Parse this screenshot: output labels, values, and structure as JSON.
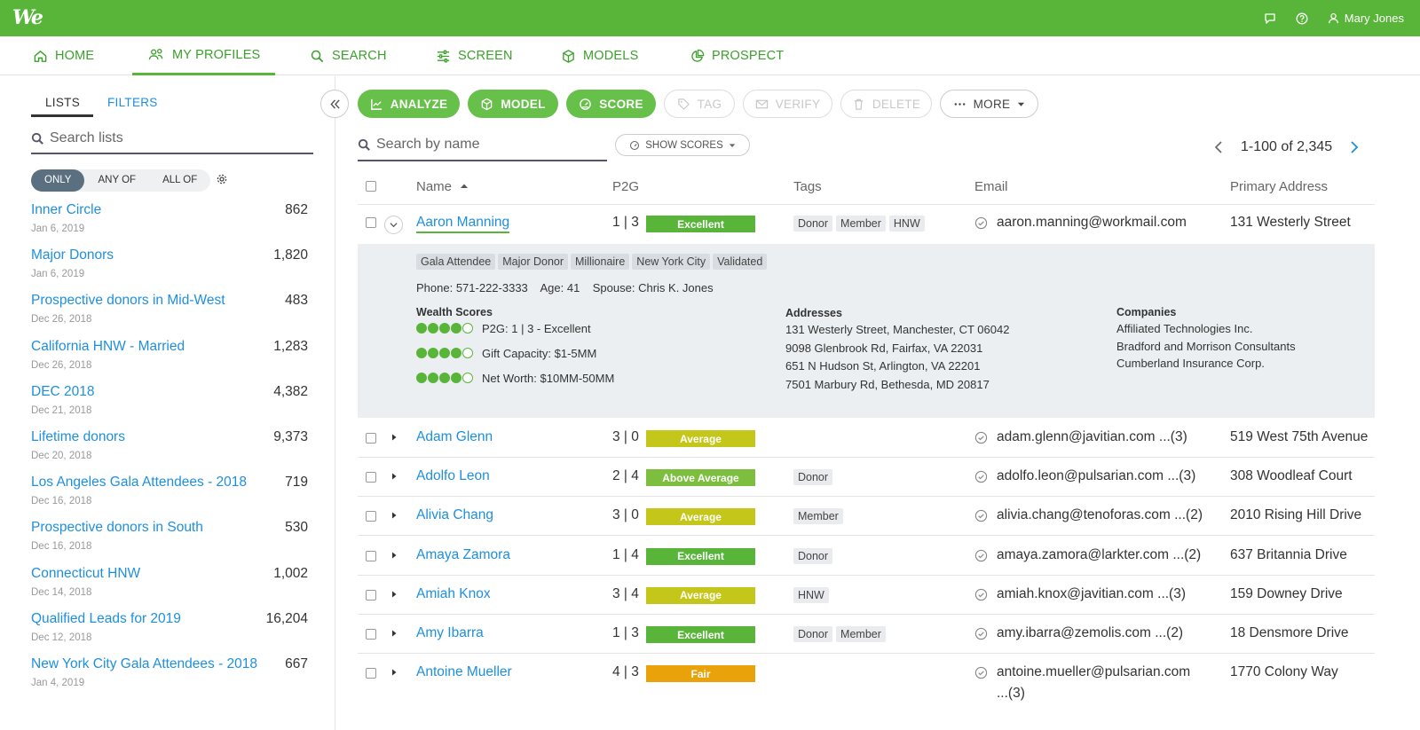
{
  "app": {
    "logo": "We",
    "user_name": "Mary Jones",
    "accent": "#59b53a",
    "link_color": "#1e8fe0"
  },
  "nav": [
    {
      "label": "HOME",
      "icon": "home-icon"
    },
    {
      "label": "MY PROFILES",
      "icon": "people-icon",
      "active": true
    },
    {
      "label": "SEARCH",
      "icon": "search-icon"
    },
    {
      "label": "SCREEN",
      "icon": "sliders-icon"
    },
    {
      "label": "MODELS",
      "icon": "cube-icon"
    },
    {
      "label": "PROSPECT",
      "icon": "pie-icon"
    }
  ],
  "sidebar": {
    "tabs": {
      "lists": "LISTS",
      "filters": "FILTERS"
    },
    "search_placeholder": "Search lists",
    "segments": {
      "only": "ONLY",
      "any": "ANY OF",
      "all": "ALL OF"
    },
    "lists": [
      {
        "name": "Inner Circle",
        "count": "862",
        "date": "Jan 6, 2019"
      },
      {
        "name": "Major Donors",
        "count": "1,820",
        "date": "Jan 6, 2019"
      },
      {
        "name": "Prospective donors in Mid-West",
        "count": "483",
        "date": "Dec 26, 2018"
      },
      {
        "name": "California HNW - Married",
        "count": "1,283",
        "date": "Dec 26, 2018"
      },
      {
        "name": "DEC 2018",
        "count": "4,382",
        "date": "Dec 21, 2018"
      },
      {
        "name": "Lifetime donors",
        "count": "9,373",
        "date": "Dec 20, 2018"
      },
      {
        "name": "Los Angeles Gala Attendees - 2018",
        "count": "719",
        "date": "Dec 16, 2018"
      },
      {
        "name": "Prospective donors in South",
        "count": "530",
        "date": "Dec 16, 2018"
      },
      {
        "name": "Connecticut HNW",
        "count": "1,002",
        "date": "Dec 14, 2018"
      },
      {
        "name": "Qualified Leads for 2019",
        "count": "16,204",
        "date": "Dec 12, 2018"
      },
      {
        "name": "New York City Gala Attendees - 2018",
        "count": "667",
        "date": "Jan 4, 2019"
      }
    ]
  },
  "toolbar": {
    "analyze": "ANALYZE",
    "model": "MODEL",
    "score": "SCORE",
    "tag": "TAG",
    "verify": "VERIFY",
    "delete": "DELETE",
    "more": "MORE"
  },
  "search_name_placeholder": "Search by name",
  "show_scores": "SHOW SCORES",
  "pager": "1-100 of 2,345",
  "columns": {
    "name": "Name",
    "p2g": "P2G",
    "tags": "Tags",
    "email": "Email",
    "address": "Primary Address"
  },
  "badge_colors": {
    "Excellent": "#59b53a",
    "Average": "#c4c61a",
    "Above Average": "#7cbf3f",
    "Fair": "#eaa20a"
  },
  "expanded": {
    "name": "Aaron Manning",
    "p2g": "1 | 3",
    "rating": "Excellent",
    "tags": [
      "Donor",
      "Member",
      "HNW"
    ],
    "email": "aaron.manning@workmail.com",
    "address": "131 Westerly Street",
    "detail_tags": [
      "Gala Attendee",
      "Major Donor",
      "Millionaire",
      "New York City",
      "Validated"
    ],
    "info": "Phone: 571-222-3333    Age: 41    Spouse: Chris K. Jones",
    "wealth_title": "Wealth Scores",
    "wealth": [
      {
        "label": "P2G: 1 | 3 - Excellent",
        "filled": 4
      },
      {
        "label": "Gift Capacity: $1-5MM",
        "filled": 4
      },
      {
        "label": "Net Worth: $10MM-50MM",
        "filled": 4
      }
    ],
    "addresses_title": "Addresses",
    "addresses": [
      "131 Westerly Street, Manchester, CT 06042",
      "9098 Glenbrook Rd, Fairfax, VA 22031",
      "651 N Hudson St, Arlington, VA 22201",
      "7501 Marbury Rd, Bethesda, MD 20817"
    ],
    "companies_title": "Companies",
    "companies": [
      "Affiliated Technologies Inc.",
      "Bradford and Morrison Consultants",
      "Cumberland Insurance Corp."
    ]
  },
  "rows": [
    {
      "name": "Adam Glenn",
      "p2g": "3 | 0",
      "rating": "Average",
      "tags": [],
      "email": "adam.glenn@javitian.com ...(3)",
      "email2": "",
      "address": "519 West 75th Avenue"
    },
    {
      "name": "Adolfo Leon",
      "p2g": "2 | 4",
      "rating": "Above Average",
      "tags": [
        "Donor"
      ],
      "email": "adolfo.leon@pulsarian.com ...(3)",
      "email2": "",
      "address": "308 Woodleaf Court"
    },
    {
      "name": "Alivia Chang",
      "p2g": "3 | 0",
      "rating": "Average",
      "tags": [
        "Member"
      ],
      "email": "alivia.chang@tenoforas.com ...(2)",
      "email2": "",
      "address": "2010 Rising Hill Drive"
    },
    {
      "name": "Amaya Zamora",
      "p2g": "1 | 4",
      "rating": "Excellent",
      "tags": [
        "Donor"
      ],
      "email": "amaya.zamora@larkter.com ...(2)",
      "email2": "",
      "address": "637 Britannia Drive"
    },
    {
      "name": "Amiah Knox",
      "p2g": "3 | 4",
      "rating": "Average",
      "tags": [
        "HNW"
      ],
      "email": "amiah.knox@javitian.com ...(3)",
      "email2": "",
      "address": "159 Downey Drive"
    },
    {
      "name": "Amy Ibarra",
      "p2g": "1 | 3",
      "rating": "Excellent",
      "tags": [
        "Donor",
        "Member"
      ],
      "email": "amy.ibarra@zemolis.com ...(2)",
      "email2": "",
      "address": "18 Densmore Drive"
    },
    {
      "name": "Antoine Mueller",
      "p2g": "4 | 3",
      "rating": "Fair",
      "tags": [],
      "email": "antoine.mueller@pulsarian.com",
      "email2": "...(3)",
      "address": "1770 Colony Way"
    }
  ]
}
